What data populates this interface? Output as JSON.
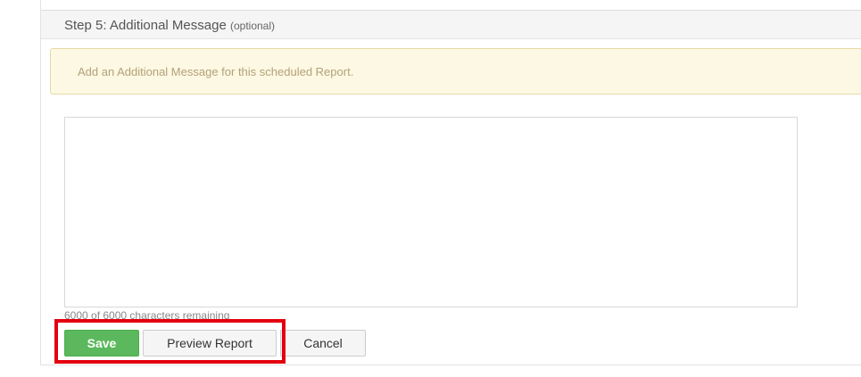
{
  "step": {
    "title": "Step 5: Additional Message",
    "optional_label": "(optional)"
  },
  "alert": {
    "text": "Add an Additional Message for this scheduled Report."
  },
  "message": {
    "value": "",
    "counter_text": "6000 of 6000 characters remaining"
  },
  "actions": {
    "save_label": "Save",
    "preview_label": "Preview Report",
    "cancel_label": "Cancel"
  },
  "colors": {
    "save_green": "#5cb85c",
    "alert_bg": "#fcf8e3",
    "highlight_red": "#e3000f"
  }
}
